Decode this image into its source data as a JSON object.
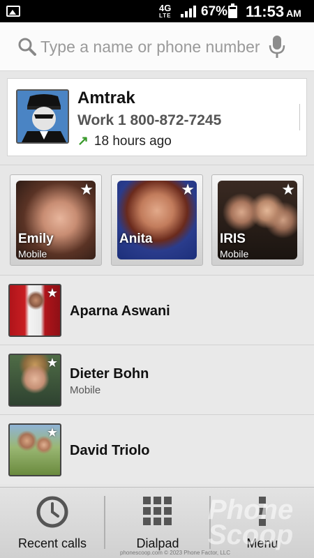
{
  "status_bar": {
    "network": "4G",
    "network_sub": "LTE",
    "battery_percent": "67%",
    "time": "11:53",
    "ampm": "AM"
  },
  "search": {
    "placeholder": "Type a name or phone number"
  },
  "recent": {
    "name": "Amtrak",
    "phone": "Work 1 800-872-7245",
    "time_ago": "18 hours ago",
    "arrow": "↗"
  },
  "favorites": [
    {
      "name": "Emily",
      "label": "Mobile"
    },
    {
      "name": "Anita",
      "label": ""
    },
    {
      "name": "IRIS",
      "label": "Mobile"
    }
  ],
  "contacts": [
    {
      "name": "Aparna Aswani",
      "sub": ""
    },
    {
      "name": "Dieter Bohn",
      "sub": "Mobile"
    },
    {
      "name": "David Triolo",
      "sub": ""
    }
  ],
  "bottom_bar": {
    "recent_calls": "Recent calls",
    "dialpad": "Dialpad",
    "menu": "Menu"
  },
  "watermark": "Phone Scoop",
  "credit": "phonescoop.com  © 2023 Phone Factor, LLC",
  "colors": {
    "accent_green": "#3a9a2c",
    "status_bar": "#000000",
    "background": "#e7e7e7"
  },
  "icons": [
    "image-icon",
    "signal-icon",
    "battery-icon",
    "search-icon",
    "mic-icon",
    "star-icon",
    "clock-icon",
    "dialpad-icon",
    "menu-icon"
  ]
}
